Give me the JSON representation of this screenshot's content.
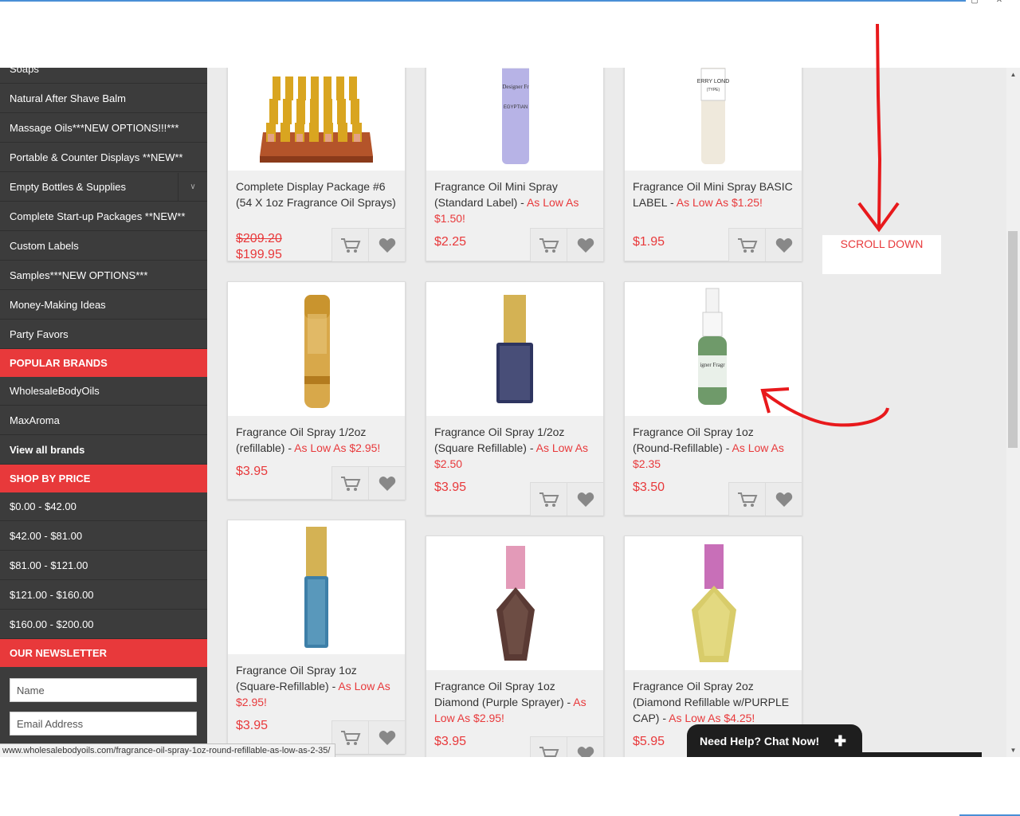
{
  "sidebar": {
    "items_top": [
      {
        "label": "Soaps"
      },
      {
        "label": "Natural After Shave Balm"
      },
      {
        "label": "Massage Oils***NEW OPTIONS!!!***"
      },
      {
        "label": "Portable & Counter Displays **NEW**"
      },
      {
        "label": "Empty Bottles & Supplies",
        "icon": "chevron-down-icon"
      },
      {
        "label": "Complete Start-up Packages **NEW**"
      },
      {
        "label": "Custom Labels"
      },
      {
        "label": "Samples***NEW OPTIONS***"
      },
      {
        "label": "Money-Making Ideas"
      },
      {
        "label": "Party Favors"
      }
    ],
    "popular_brands": {
      "heading": "POPULAR BRANDS",
      "items": [
        {
          "label": "WholesaleBodyOils"
        },
        {
          "label": "MaxAroma"
        },
        {
          "label": "View all brands"
        }
      ]
    },
    "shop_by_price": {
      "heading": "SHOP BY PRICE",
      "items": [
        {
          "label": "$0.00 - $42.00"
        },
        {
          "label": "$42.00 - $81.00"
        },
        {
          "label": "$81.00 - $121.00"
        },
        {
          "label": "$121.00 - $160.00"
        },
        {
          "label": "$160.00 - $200.00"
        }
      ]
    },
    "newsletter": {
      "heading": "OUR NEWSLETTER",
      "name_placeholder": "Name",
      "email_placeholder": "Email Address"
    }
  },
  "products": [
    {
      "title": "Complete Display Package #6 (54 X 1oz Fragrance Oil Sprays)",
      "low": "",
      "old_price": "$209.20",
      "price": "$199.95"
    },
    {
      "title": "Fragrance Oil Mini Spray (Standard Label) - ",
      "low": "As Low As $1.50!",
      "price": "$2.25",
      "image_label": "Designer Fragrances MINI SPRAY EGYPTIAN MUSK"
    },
    {
      "title": "Fragrance Oil Mini Spray BASIC LABEL - ",
      "low": "As Low As $1.25!",
      "price": "$1.95",
      "image_label": "BERRY LONDON (TYPE)"
    },
    {
      "title": "Fragrance Oil Spray 1/2oz (refillable) - ",
      "low": "As Low As $2.95!",
      "price": "$3.95"
    },
    {
      "title": "Fragrance Oil Spray 1/2oz (Square Refillable) - ",
      "low": "As Low As $2.50",
      "price": "$3.95"
    },
    {
      "title": "Fragrance Oil Spray 1oz (Round-Refillable) - ",
      "low": "As Low As $2.35",
      "price": "$3.50",
      "image_label": "Designer Fragrances"
    },
    {
      "title": "Fragrance Oil Spray 1oz (Square-Refillable) - ",
      "low": "As Low As $2.95!",
      "price": "$3.95"
    },
    {
      "title": "Fragrance Oil Spray 1oz Diamond (Purple Sprayer) - ",
      "low": "As Low As $2.95!",
      "price": "$3.95"
    },
    {
      "title": "Fragrance Oil Spray 2oz (Diamond Refillable w/PURPLE CAP) - ",
      "low": "As Low As $4.25!",
      "price": "$5.95"
    }
  ],
  "annotation": {
    "text": "SCROLL DOWN",
    "color": "#e8393b"
  },
  "chat": {
    "label": "Need Help? Chat Now!",
    "icon": "plus-icon"
  },
  "status_url": "www.wholesalebodyoils.com/fragrance-oil-spray-1oz-round-refillable-as-low-as-2-35/",
  "colors": {
    "accent": "#e8393b",
    "sidebar": "#3c3c3c",
    "background": "#ebebeb"
  }
}
